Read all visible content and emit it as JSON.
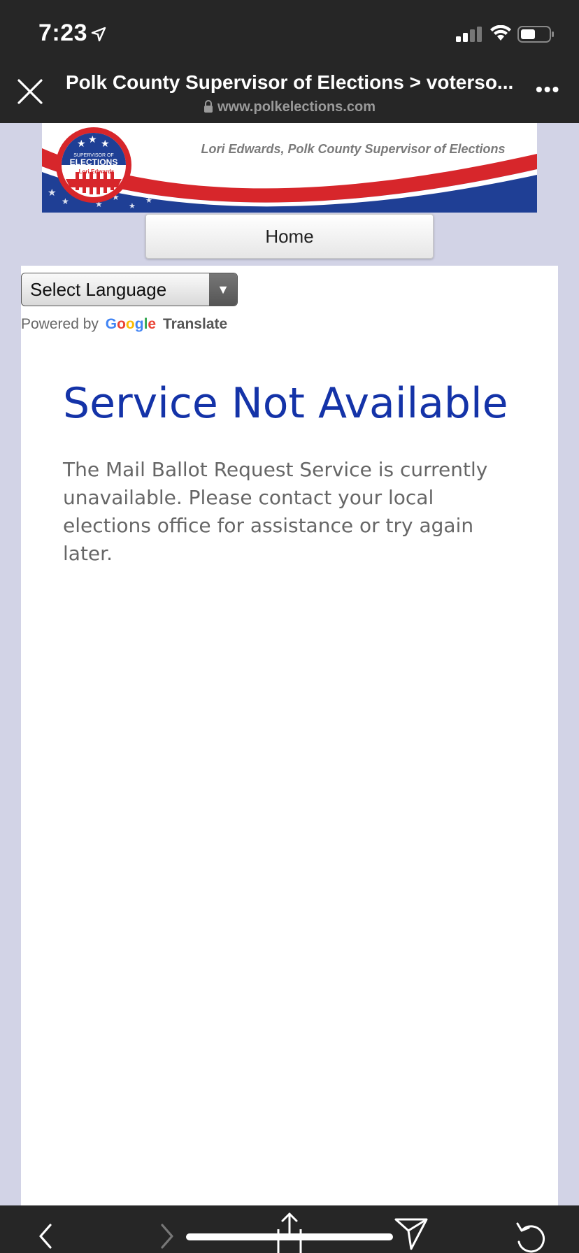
{
  "status_bar": {
    "time": "7:23",
    "icons": [
      "location-arrow-icon",
      "signal-icon",
      "wifi-icon",
      "battery-icon"
    ]
  },
  "browser": {
    "title": "Polk County Supervisor of Elections > voterso...",
    "url": "www.polkelections.com",
    "close_icon": "close-icon",
    "more_label": "•••"
  },
  "banner": {
    "tagline": "Lori Edwards, Polk County Supervisor of Elections",
    "seal_top": "SUPERVISOR OF",
    "seal_main": "ELECTIONS",
    "seal_name": "Lori Edwards"
  },
  "nav": {
    "home_label": "Home"
  },
  "translate": {
    "select_label": "Select Language",
    "powered_by": "Powered by",
    "google": "Google",
    "translate": "Translate"
  },
  "main": {
    "heading": "Service Not Available",
    "message": "The Mail Ballot Request Service is currently unavailable. Please contact your local elections office for assistance or try again later."
  },
  "toolbar": {
    "icons": [
      "back-icon",
      "forward-icon",
      "share-icon",
      "send-icon",
      "reload-icon"
    ]
  },
  "colors": {
    "heading": "#1433a8",
    "chrome": "#262626",
    "page_bg": "#d2d3e6",
    "banner_red": "#d7262b",
    "banner_blue": "#1f3f95"
  }
}
